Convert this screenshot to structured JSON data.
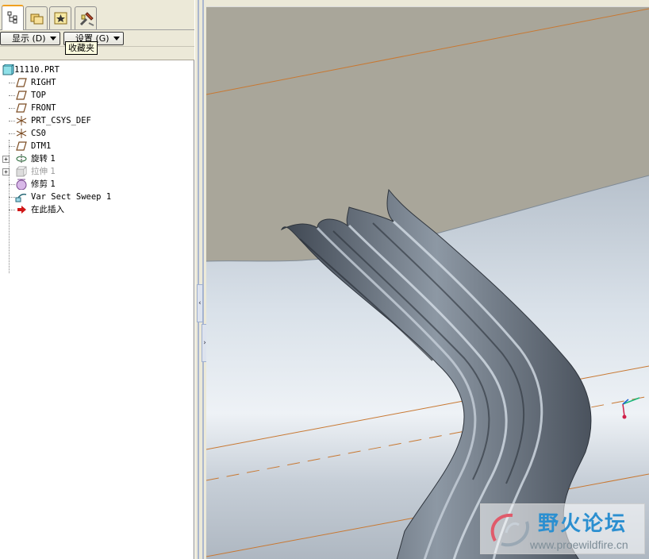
{
  "navigator": {
    "tabs": [
      {
        "name": "model-tree-tab",
        "icon": "model-tree-icon",
        "active": true
      },
      {
        "name": "folder-browser-tab",
        "icon": "folder-icon",
        "active": false
      },
      {
        "name": "favorites-tab",
        "icon": "favorites-star-icon",
        "active": false
      },
      {
        "name": "connections-tab",
        "icon": "tools-icon",
        "active": false
      }
    ],
    "show_button": "显示 (D)",
    "settings_button": "设置 (G)",
    "tooltip": "收藏夹"
  },
  "model_tree": {
    "root": "11110.PRT",
    "items": [
      {
        "label": "RIGHT",
        "icon": "datum-plane-icon",
        "dim": false,
        "expandable": false
      },
      {
        "label": "TOP",
        "icon": "datum-plane-icon",
        "dim": false,
        "expandable": false
      },
      {
        "label": "FRONT",
        "icon": "datum-plane-icon",
        "dim": false,
        "expandable": false
      },
      {
        "label": "PRT_CSYS_DEF",
        "icon": "coordinate-system-icon",
        "dim": false,
        "expandable": false
      },
      {
        "label": "CS0",
        "icon": "coordinate-system-icon",
        "dim": false,
        "expandable": false
      },
      {
        "label": "DTM1",
        "icon": "datum-plane-icon",
        "dim": false,
        "expandable": false
      },
      {
        "label": "旋转 1",
        "icon": "revolve-icon",
        "dim": false,
        "expandable": true
      },
      {
        "label": "拉伸 1",
        "icon": "extrude-icon",
        "dim": true,
        "expandable": true
      },
      {
        "label": "修剪 1",
        "icon": "trim-icon",
        "dim": false,
        "expandable": false
      },
      {
        "label": "Var Sect Sweep 1",
        "icon": "variable-sweep-icon",
        "dim": false,
        "expandable": false
      },
      {
        "label": "在此插入",
        "icon": "insert-here-arrow-icon",
        "dim": false,
        "expandable": false
      }
    ]
  },
  "splitter": {
    "collapse_glyph": "‹",
    "expand_glyph": "›"
  },
  "watermark": {
    "title": "野火论坛",
    "url": "www.proewildfire.cn"
  },
  "colors": {
    "datum_line": "#c87832",
    "background_top": "#a9a69a",
    "surface": "#c8d2dc",
    "feature": "#5b6470",
    "watermark_blue": "#2b8fd0"
  }
}
